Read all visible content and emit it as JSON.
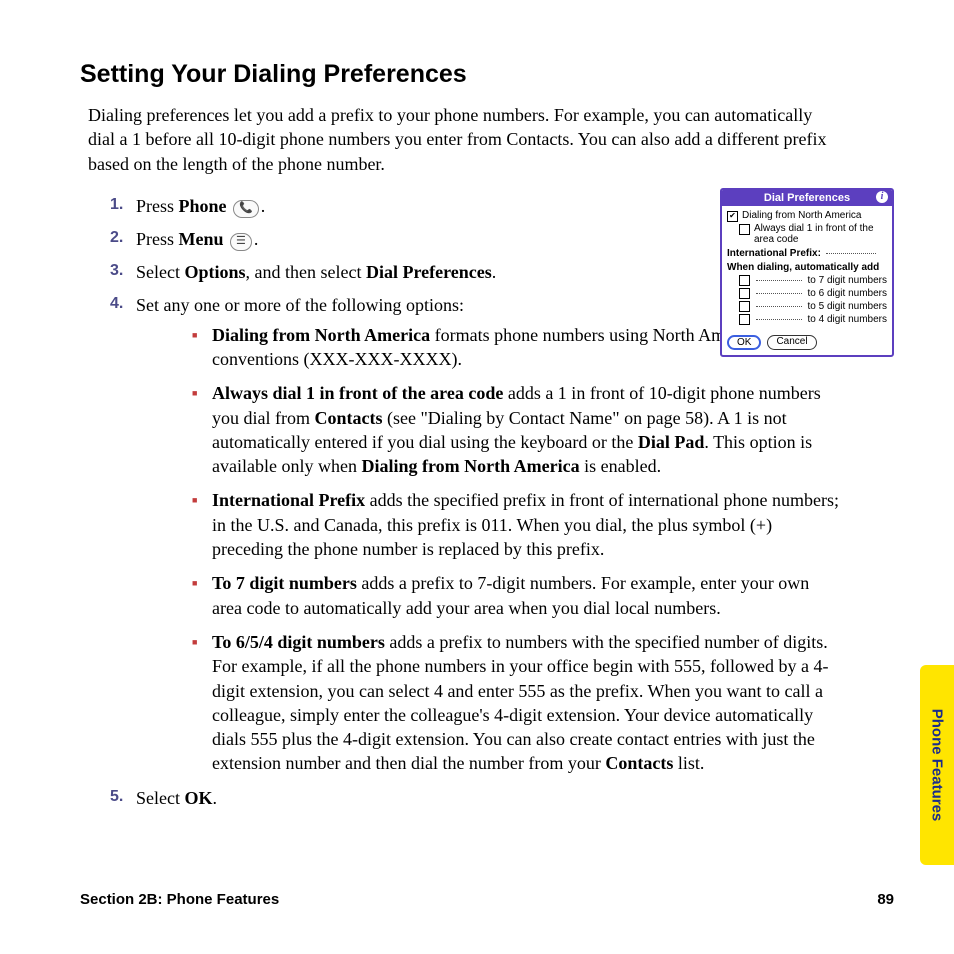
{
  "title": "Setting Your Dialing Preferences",
  "intro": "Dialing preferences let you add a prefix to your phone numbers. For example, you can automatically dial a 1 before all 10-digit phone numbers you enter from Contacts. You can also add a different prefix based on the length of the phone number.",
  "steps": {
    "s1": {
      "num": "1.",
      "pre": "Press ",
      "bold": "Phone",
      "icon": "📞",
      "post": "."
    },
    "s2": {
      "num": "2.",
      "pre": "Press ",
      "bold": "Menu",
      "icon": "☰",
      "post": "."
    },
    "s3": {
      "num": "3.",
      "pre": "Select ",
      "bold1": "Options",
      "mid": ", and then select ",
      "bold2": "Dial Preferences",
      "post": "."
    },
    "s4": {
      "num": "4.",
      "text": "Set any one or more of the following options:"
    },
    "s5": {
      "num": "5.",
      "pre": "Select ",
      "bold": "OK",
      "post": "."
    }
  },
  "bullets": {
    "b1": {
      "bold": "Dialing from North America",
      "rest": " formats phone numbers using North American conventions (XXX-XXX-XXXX)."
    },
    "b2": {
      "bold": "Always dial 1 in front of the area code",
      "p1": " adds a 1 in front of 10-digit phone numbers you dial from ",
      "bold2": "Contacts",
      "p2": " (see \"Dialing by Contact Name\" on page 58). A 1 is not automatically entered if you dial using the keyboard or the ",
      "bold3": "Dial Pad",
      "p3": ". This option is available only when ",
      "bold4": "Dialing from North America",
      "p4": " is enabled."
    },
    "b3": {
      "bold": "International Prefix",
      "rest": " adds the specified prefix in front of international phone numbers; in the U.S. and Canada, this prefix is 011. When you dial, the plus symbol (+) preceding the phone number is replaced by this prefix."
    },
    "b4": {
      "bold": "To 7 digit numbers",
      "rest": " adds a prefix to 7-digit numbers. For example, enter your own area code to automatically add your area when you dial local numbers."
    },
    "b5": {
      "bold": "To 6/5/4 digit numbers",
      "p1": " adds a prefix to numbers with the specified number of digits. For example, if all the phone numbers in your office begin with 555, followed by a 4-digit extension, you can select 4 and enter 555 as the prefix. When you want to call a colleague, simply enter the colleague's 4-digit extension. Your device automatically dials 555 plus the 4-digit extension. You can also create contact entries with just the extension number and then dial the number from your ",
      "bold2": "Contacts",
      "p2": " list."
    }
  },
  "figure": {
    "title": "Dial Preferences",
    "info": "i",
    "opt1": "Dialing from North America",
    "opt2": "Always dial 1 in front of the area code",
    "intl_label": "International Prefix:",
    "autoadd": "When dialing, automatically add",
    "to7": "to 7 digit numbers",
    "to6": "to 6 digit numbers",
    "to5": "to 5 digit numbers",
    "to4": "to 4 digit numbers",
    "ok": "OK",
    "cancel": "Cancel"
  },
  "sideTab": "Phone Features",
  "footer": {
    "section": "Section 2B: Phone Features",
    "page": "89"
  }
}
